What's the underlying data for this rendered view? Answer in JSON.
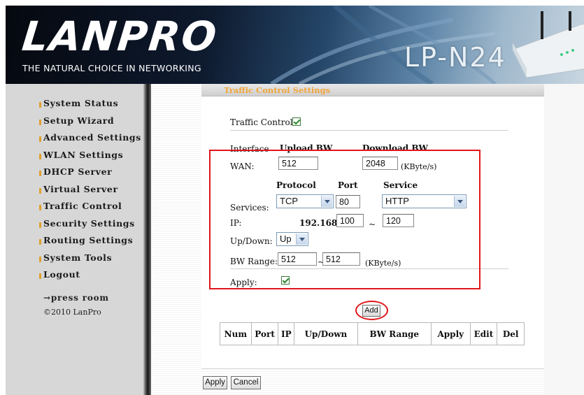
{
  "header": {
    "brand": "LANPRO",
    "tagline": "THE NATURAL CHOICE IN NETWORKING",
    "model": "LP-N24"
  },
  "sidebar": {
    "items": [
      {
        "label": "System Status"
      },
      {
        "label": "Setup Wizard"
      },
      {
        "label": "Advanced Settings"
      },
      {
        "label": "WLAN Settings"
      },
      {
        "label": "DHCP Server"
      },
      {
        "label": "Virtual Server"
      },
      {
        "label": "Traffic Control"
      },
      {
        "label": "Security Settings"
      },
      {
        "label": "Routing Settings"
      },
      {
        "label": "System Tools"
      },
      {
        "label": "Logout"
      }
    ],
    "press_room": "→press room",
    "copyright": "©2010 LanPro"
  },
  "page": {
    "title": "Traffic Control Settings",
    "traffic_control_label": "Traffic Control",
    "traffic_control_checked": true
  },
  "wan": {
    "interface_label": "Interface",
    "upload_label": "Upload BW",
    "download_label": "Download BW",
    "row_label": "WAN:",
    "upload_value": "512",
    "download_value": "2048",
    "unit": "(KByte/s)"
  },
  "rule": {
    "protocol_header": "Protocol",
    "port_header": "Port",
    "service_header": "Service",
    "services_label": "Services:",
    "protocol_value": "TCP",
    "port_value": "80",
    "service_value": "HTTP",
    "ip_label": "IP:",
    "ip_prefix": "192.168.0.",
    "ip_from": "100",
    "ip_sep": "~",
    "ip_to": "120",
    "updown_label": "Up/Down:",
    "updown_value": "Up",
    "bw_label": "BW Range:",
    "bw_from": "512",
    "bw_sep": "~",
    "bw_to": "512",
    "bw_unit": "(KByte/s)",
    "apply_label": "Apply:",
    "apply_checked": true
  },
  "add_button": "Add",
  "table": {
    "headers": [
      "Num",
      "Port",
      "IP",
      "Up/Down",
      "BW Range",
      "Apply",
      "Edit",
      "Del"
    ]
  },
  "footer": {
    "apply": "Apply",
    "cancel": "Cancel"
  },
  "colors": {
    "highlight": "#e0161b",
    "title": "#f0a438",
    "nav_bullet": "#e0a030"
  }
}
